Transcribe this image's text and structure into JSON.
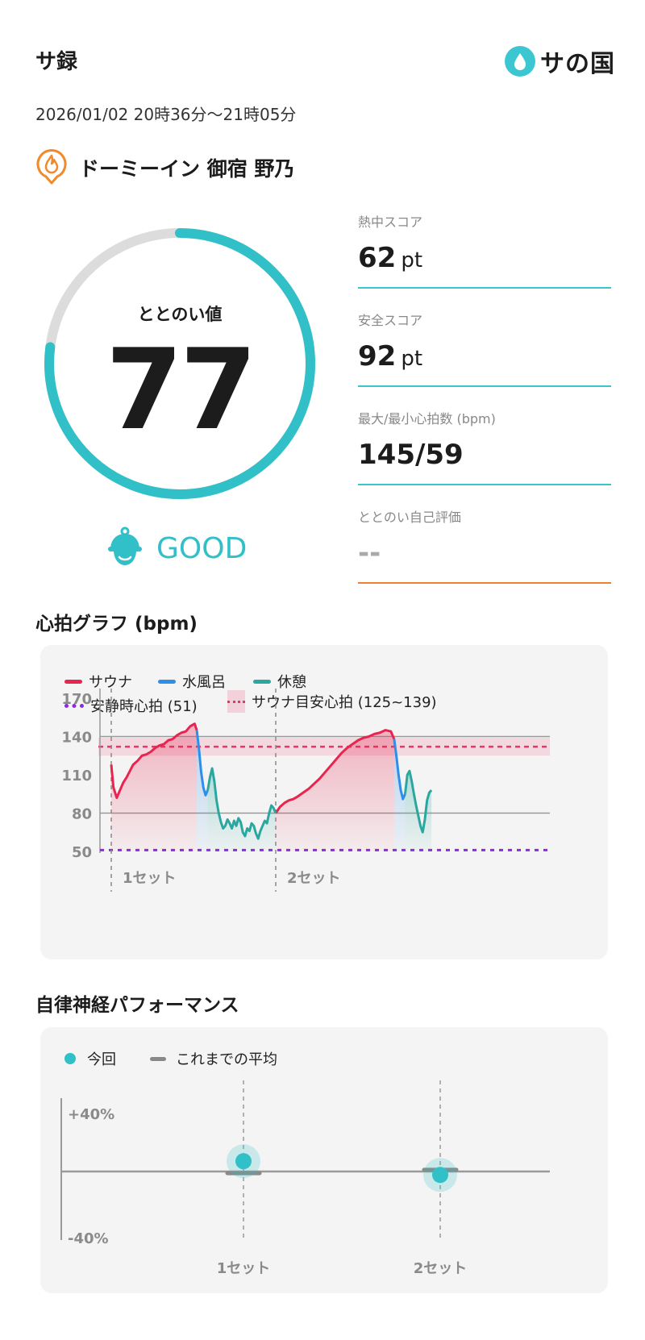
{
  "header": {
    "title": "サ録",
    "logo_text": "サの国"
  },
  "session": {
    "datetime": "2026/01/02 20時36分〜21時05分",
    "facility": "ドーミーイン 御宿 野乃"
  },
  "gauge": {
    "label": "ととのい値",
    "value": "77",
    "fraction": 0.77,
    "rating": "GOOD"
  },
  "scores": [
    {
      "label": "熱中スコア",
      "value": "62",
      "unit": "pt"
    },
    {
      "label": "安全スコア",
      "value": "92",
      "unit": "pt"
    },
    {
      "label": "最大/最小心拍数 (bpm)",
      "value": "145/59",
      "unit": ""
    },
    {
      "label": "ととのい自己評価",
      "value": "--",
      "unit": ""
    }
  ],
  "colors": {
    "accent": "#32c0c8",
    "sauna": "#e8254f",
    "cold_bath": "#2e8fe8",
    "rest": "#2aa8a0",
    "resting_hr": "#8a2be2",
    "self_eval_line": "#f08030"
  },
  "heart_section": {
    "title": "心拍グラフ (bpm)"
  },
  "autonomic_section": {
    "title": "自律神経パフォーマンス"
  },
  "chart_data": [
    {
      "type": "line",
      "legend": [
        "サウナ",
        "水風呂",
        "休憩",
        "安静時心拍 (51)",
        "サウナ目安心拍 (125~139)"
      ],
      "ylim": [
        50,
        170
      ],
      "yticks": [
        "170",
        "140",
        "110",
        "80",
        "50"
      ],
      "resting_hr": 51,
      "target_zone": [
        125,
        139
      ],
      "set_labels": [
        "1セット",
        "2セット"
      ],
      "series": [
        {
          "name": "サウナ",
          "segments": [
            {
              "x": [
                0,
                2,
                5,
                8,
                11,
                14,
                17,
                20,
                24,
                28,
                32,
                36,
                40,
                44,
                48,
                52,
                56,
                60,
                64,
                68,
                72,
                76,
                78
              ],
              "y": [
                118,
                100,
                92,
                98,
                104,
                108,
                113,
                118,
                121,
                125,
                126,
                128,
                131,
                133,
                134,
                137,
                138,
                141,
                143,
                144,
                148,
                150,
                145
              ]
            },
            {
              "x": [
                150,
                154,
                158,
                162,
                166,
                170,
                175,
                180,
                185,
                190,
                195,
                200,
                205,
                210,
                215,
                220,
                225,
                230,
                235,
                240,
                245,
                250,
                255,
                258
              ],
              "y": [
                80,
                85,
                88,
                90,
                91,
                93,
                96,
                99,
                103,
                107,
                112,
                117,
                122,
                127,
                131,
                134,
                137,
                139,
                140,
                142,
                143,
                145,
                144,
                138
              ]
            }
          ]
        },
        {
          "name": "水風呂",
          "segments": [
            {
              "x": [
                78,
                80,
                82,
                84,
                86,
                88
              ],
              "y": [
                145,
                130,
                112,
                100,
                94,
                98
              ]
            },
            {
              "x": [
                258,
                260,
                262,
                264,
                266,
                268
              ],
              "y": [
                138,
                125,
                110,
                98,
                91,
                95
              ]
            }
          ]
        },
        {
          "name": "休憩",
          "segments": [
            {
              "x": [
                88,
                90,
                92,
                94,
                96,
                98,
                100,
                102,
                104,
                106,
                108,
                110,
                112,
                114,
                116,
                118,
                120,
                122,
                124,
                126,
                128,
                130,
                132,
                134,
                136,
                138,
                140,
                142,
                144,
                146,
                148,
                150
              ],
              "y": [
                98,
                108,
                115,
                105,
                90,
                80,
                73,
                68,
                70,
                75,
                72,
                68,
                74,
                70,
                76,
                73,
                65,
                62,
                68,
                66,
                72,
                70,
                64,
                60,
                66,
                70,
                74,
                72,
                80,
                86,
                84,
                80
              ]
            },
            {
              "x": [
                268,
                270,
                272,
                274,
                276,
                278,
                280,
                282,
                284,
                286,
                288,
                290,
                292
              ],
              "y": [
                95,
                110,
                113,
                105,
                95,
                86,
                78,
                70,
                65,
                75,
                90,
                96,
                98
              ]
            }
          ]
        }
      ]
    },
    {
      "type": "scatter",
      "legend": [
        "今回",
        "これまでの平均"
      ],
      "yticks": [
        "+40%",
        "-40%"
      ],
      "ylim": [
        -40,
        40
      ],
      "categories": [
        "1セット",
        "2セット"
      ],
      "current": [
        6,
        -2
      ],
      "average": [
        -1,
        1
      ]
    }
  ]
}
